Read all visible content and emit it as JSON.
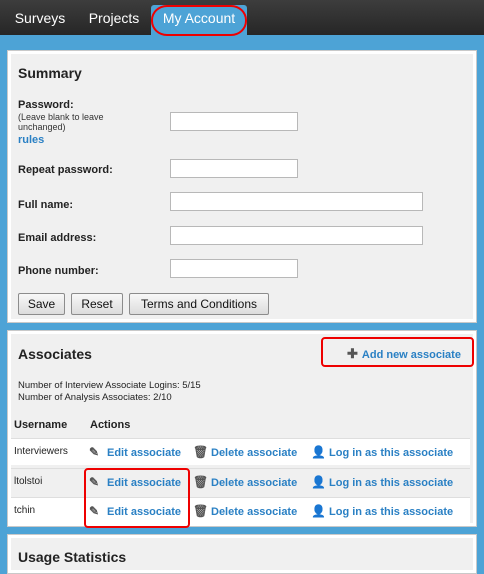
{
  "nav": {
    "tabs": [
      {
        "label": "Surveys"
      },
      {
        "label": "Projects"
      },
      {
        "label": "My Account"
      }
    ]
  },
  "summary": {
    "title": "Summary",
    "password_label": "Password:",
    "password_note": "(Leave blank to leave unchanged)",
    "rules_link": "rules",
    "repeat_password_label": "Repeat password:",
    "full_name_label": "Full name:",
    "email_label": "Email address:",
    "phone_label": "Phone number:",
    "buttons": {
      "save": "Save",
      "reset": "Reset",
      "terms": "Terms and Conditions"
    }
  },
  "associates": {
    "title": "Associates",
    "add_link": "Add new associate",
    "interview_logins": "Number of Interview Associate Logins: 5/15",
    "analysis_associates": "Number of Analysis Associates: 2/10",
    "col_username": "Username",
    "col_actions": "Actions",
    "rows": [
      {
        "username": "Interviewers",
        "edit": "Edit associate",
        "delete": "Delete associate",
        "login": "Log in as this associate"
      },
      {
        "username": "ltolstoi",
        "edit": "Edit associate",
        "delete": "Delete associate",
        "login": "Log in as this associate"
      },
      {
        "username": "tchin",
        "edit": "Edit associate",
        "delete": "Delete associate",
        "login": "Log in as this associate"
      }
    ]
  },
  "usage": {
    "title": "Usage Statistics"
  },
  "icons": {
    "edit": "pencil-icon",
    "delete": "trash-icon",
    "login": "user-login-icon",
    "add": "plus-icon"
  },
  "colors": {
    "accent": "#4da3d6",
    "link": "#2a80c4",
    "highlight": "#e00000"
  }
}
